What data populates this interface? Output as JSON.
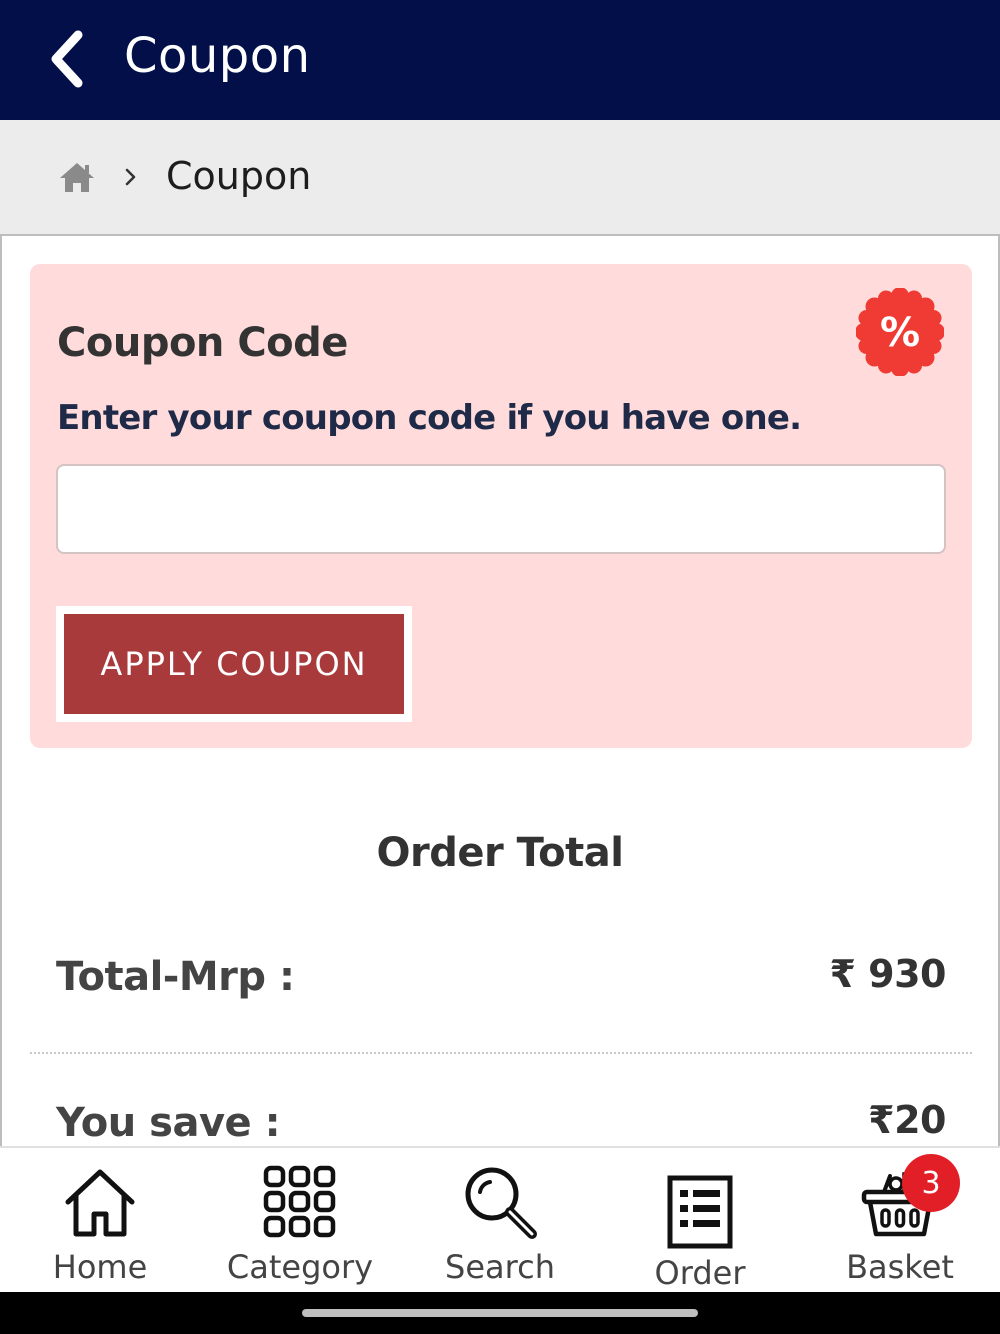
{
  "header": {
    "title": "Coupon",
    "back_icon": "chevron-left-icon"
  },
  "breadcrumb": {
    "home_icon": "home-icon",
    "separator_icon": "chevron-right-icon",
    "current": "Coupon"
  },
  "coupon": {
    "title": "Coupon Code",
    "description": "Enter your coupon code if you have one.",
    "input_value": "",
    "input_placeholder": "",
    "apply_label": "APPLY COUPON",
    "badge_icon": "percent-badge-icon",
    "badge_text": "%"
  },
  "order_total": {
    "heading": "Order Total",
    "rows": [
      {
        "label": "Total-Mrp :",
        "value": "₹ 930"
      },
      {
        "label": "You save :",
        "value": "₹20"
      }
    ]
  },
  "bottom_nav": {
    "items": [
      {
        "label": "Home",
        "icon": "home-icon"
      },
      {
        "label": "Category",
        "icon": "grid-icon"
      },
      {
        "label": "Search",
        "icon": "search-icon"
      },
      {
        "label": "Order",
        "icon": "order-list-icon"
      },
      {
        "label": "Basket",
        "icon": "basket-icon",
        "badge": "3"
      }
    ]
  },
  "colors": {
    "header_bg": "#020f48",
    "card_bg": "#ffdcdb",
    "button_bg": "#a93a3c",
    "badge_red": "#e21e26",
    "percent_red": "#ef3b34"
  }
}
